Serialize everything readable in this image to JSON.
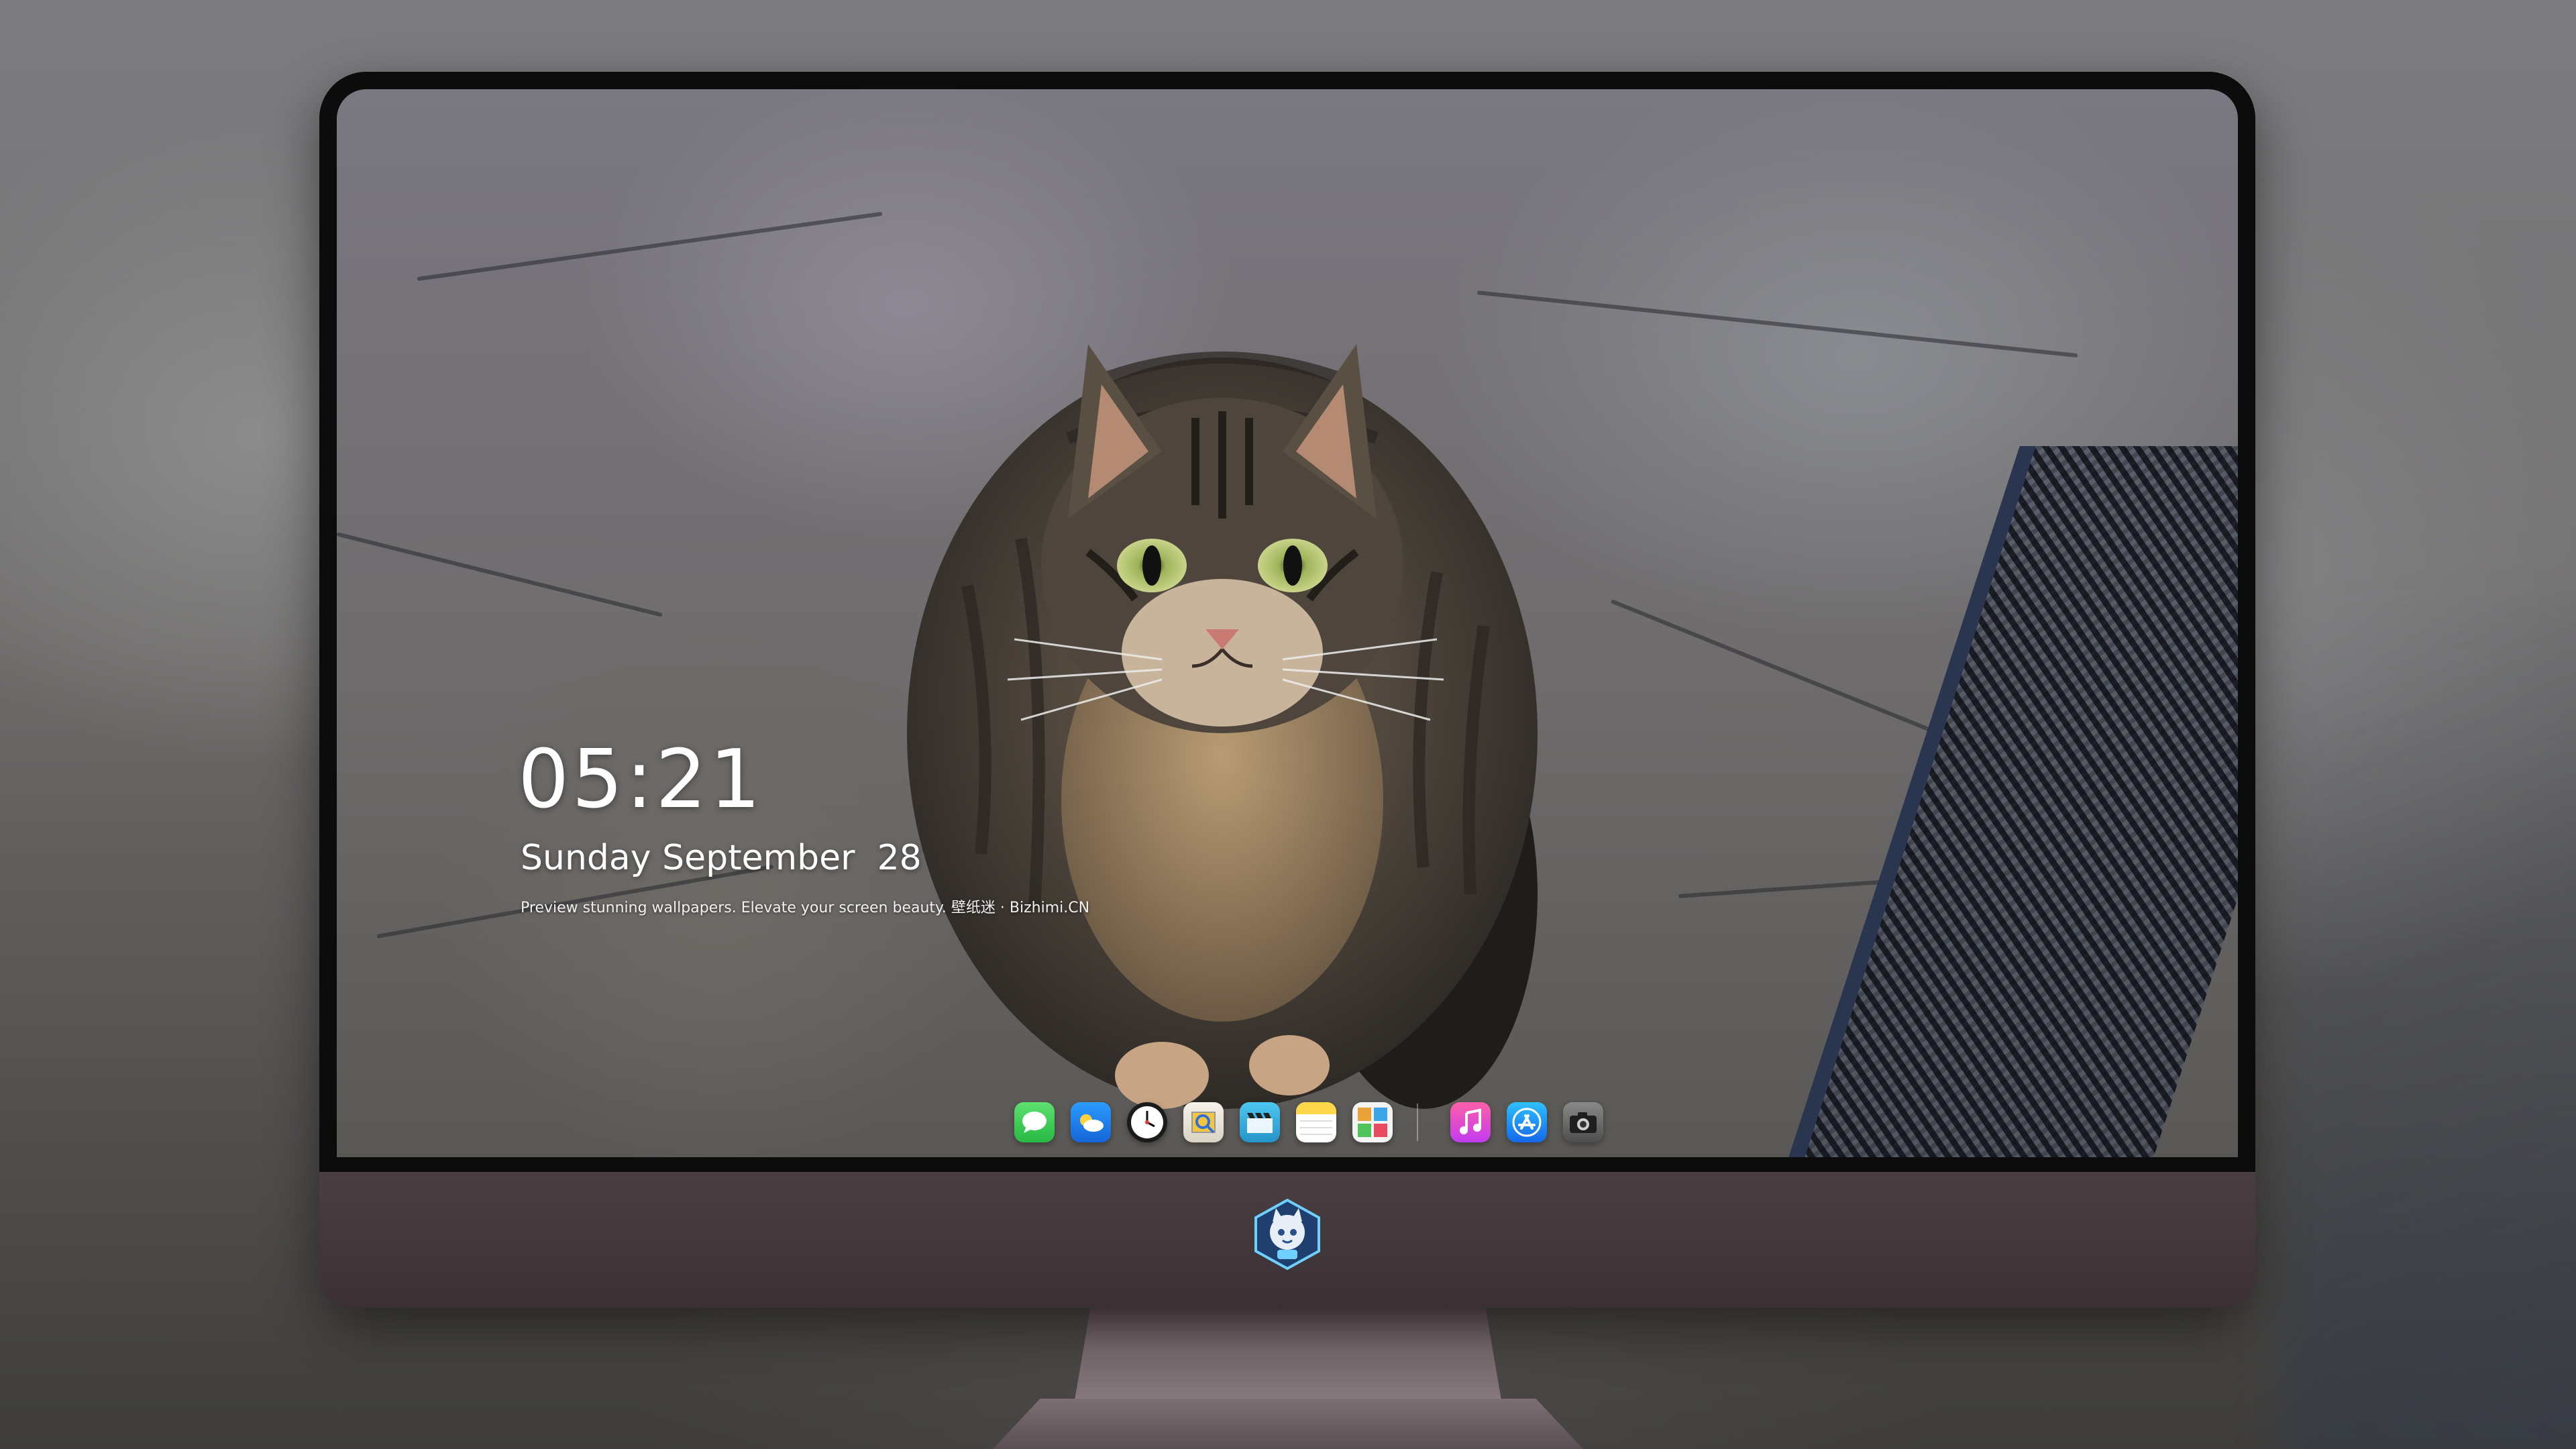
{
  "lockscreen": {
    "time": "05:21",
    "date": "Sunday September  28",
    "tagline": "Preview stunning wallpapers. Elevate your screen beauty. 壁纸迷 · Bizhimi.CN"
  },
  "dock": {
    "apps": [
      {
        "name": "messages-icon",
        "color": "#34c759"
      },
      {
        "name": "weather-icon",
        "color": "#1e90ff"
      },
      {
        "name": "clock-icon",
        "color": "#ffffff"
      },
      {
        "name": "preview-icon",
        "color": "#f4c542"
      },
      {
        "name": "clips-icon",
        "color": "#3db8e6"
      },
      {
        "name": "notes-icon",
        "color": "#ffd84a"
      },
      {
        "name": "photo-booth-icon",
        "color": "#e8a33a"
      },
      {
        "name": "music-icon",
        "color": "#fc3c8c"
      },
      {
        "name": "app-store-icon",
        "color": "#1a8cff"
      },
      {
        "name": "camera-icon",
        "color": "#6f6f6f"
      }
    ]
  },
  "colors": {
    "chin": "#3f3438",
    "bezel": "#0c0c0d",
    "text": "#ffffff"
  }
}
